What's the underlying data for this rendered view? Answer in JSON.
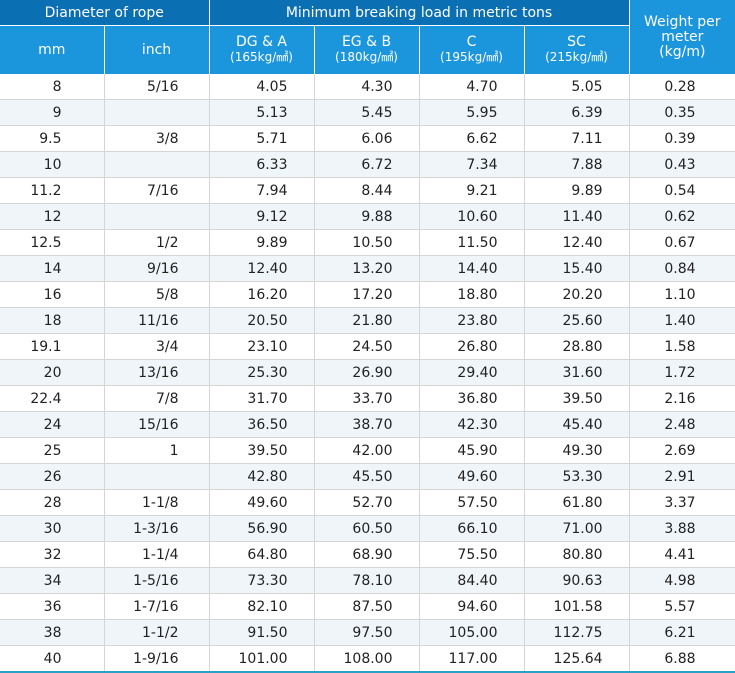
{
  "header": {
    "diameter": "Diameter of rope",
    "min_load": "Minimum breaking load in metric tons",
    "weight_line1": "Weight per",
    "weight_line2": "meter",
    "weight_line3": "(kg/m)",
    "mm": "mm",
    "inch": "inch",
    "grades": [
      {
        "name": "DG & A",
        "unit": "(165kg/㎟)"
      },
      {
        "name": "EG & B",
        "unit": "(180kg/㎟)"
      },
      {
        "name": "C",
        "unit": "(195kg/㎟)"
      },
      {
        "name": "SC",
        "unit": "(215kg/㎟)"
      }
    ]
  },
  "rows": [
    [
      "8",
      "5/16",
      "4.05",
      "4.30",
      "4.70",
      "5.05",
      "0.28"
    ],
    [
      "9",
      "",
      "5.13",
      "5.45",
      "5.95",
      "6.39",
      "0.35"
    ],
    [
      "9.5",
      "3/8",
      "5.71",
      "6.06",
      "6.62",
      "7.11",
      "0.39"
    ],
    [
      "10",
      "",
      "6.33",
      "6.72",
      "7.34",
      "7.88",
      "0.43"
    ],
    [
      "11.2",
      "7/16",
      "7.94",
      "8.44",
      "9.21",
      "9.89",
      "0.54"
    ],
    [
      "12",
      "",
      "9.12",
      "9.88",
      "10.60",
      "11.40",
      "0.62"
    ],
    [
      "12.5",
      "1/2",
      "9.89",
      "10.50",
      "11.50",
      "12.40",
      "0.67"
    ],
    [
      "14",
      "9/16",
      "12.40",
      "13.20",
      "14.40",
      "15.40",
      "0.84"
    ],
    [
      "16",
      "5/8",
      "16.20",
      "17.20",
      "18.80",
      "20.20",
      "1.10"
    ],
    [
      "18",
      "11/16",
      "20.50",
      "21.80",
      "23.80",
      "25.60",
      "1.40"
    ],
    [
      "19.1",
      "3/4",
      "23.10",
      "24.50",
      "26.80",
      "28.80",
      "1.58"
    ],
    [
      "20",
      "13/16",
      "25.30",
      "26.90",
      "29.40",
      "31.60",
      "1.72"
    ],
    [
      "22.4",
      "7/8",
      "31.70",
      "33.70",
      "36.80",
      "39.50",
      "2.16"
    ],
    [
      "24",
      "15/16",
      "36.50",
      "38.70",
      "42.30",
      "45.40",
      "2.48"
    ],
    [
      "25",
      "1",
      "39.50",
      "42.00",
      "45.90",
      "49.30",
      "2.69"
    ],
    [
      "26",
      "",
      "42.80",
      "45.50",
      "49.60",
      "53.30",
      "2.91"
    ],
    [
      "28",
      "1-1/8",
      "49.60",
      "52.70",
      "57.50",
      "61.80",
      "3.37"
    ],
    [
      "30",
      "1-3/16",
      "56.90",
      "60.50",
      "66.10",
      "71.00",
      "3.88"
    ],
    [
      "32",
      "1-1/4",
      "64.80",
      "68.90",
      "75.50",
      "80.80",
      "4.41"
    ],
    [
      "34",
      "1-5/16",
      "73.30",
      "78.10",
      "84.40",
      "90.63",
      "4.98"
    ],
    [
      "36",
      "1-7/16",
      "82.10",
      "87.50",
      "94.60",
      "101.58",
      "5.57"
    ],
    [
      "38",
      "1-1/2",
      "91.50",
      "97.50",
      "105.00",
      "112.75",
      "6.21"
    ],
    [
      "40",
      "1-9/16",
      "101.00",
      "108.00",
      "117.00",
      "125.64",
      "6.88"
    ]
  ],
  "colors": {
    "header_dark": "#0b6fb3",
    "header_light": "#1b96dc",
    "row_alt": "#f0f5f9"
  }
}
